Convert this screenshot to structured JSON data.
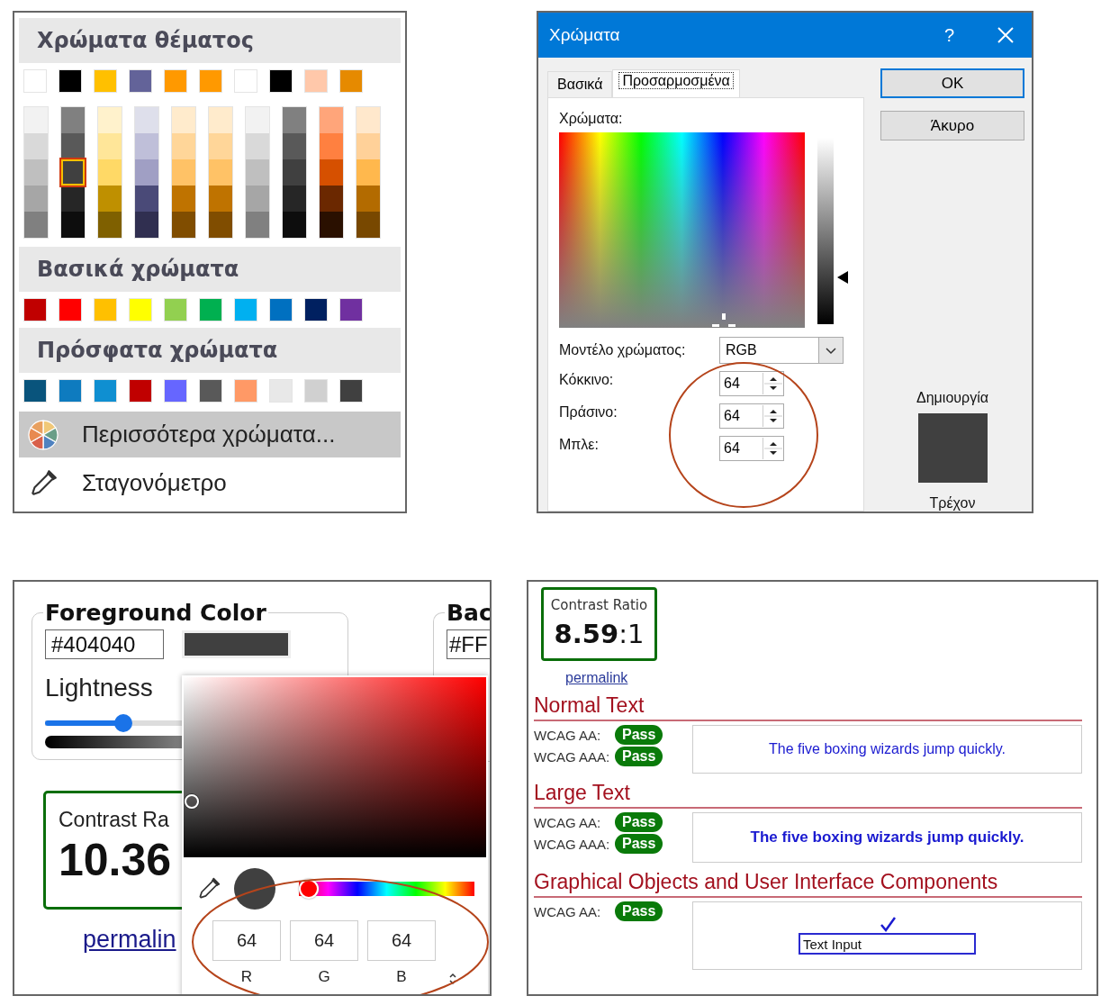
{
  "color_menu": {
    "theme_heading": "Χρώματα θέματος",
    "theme_colors": [
      {
        "color": "#ffffff",
        "shades": [
          {
            "color": "#f2f2f2",
            "selected": false
          },
          {
            "color": "#d9d9d9",
            "selected": false
          },
          {
            "color": "#bfbfbf",
            "selected": false
          },
          {
            "color": "#a6a6a6",
            "selected": false
          },
          {
            "color": "#808080",
            "selected": false
          }
        ]
      },
      {
        "color": "#000000",
        "shades": [
          {
            "color": "#808080",
            "selected": false
          },
          {
            "color": "#595959",
            "selected": false
          },
          {
            "color": "#404040",
            "selected": true
          },
          {
            "color": "#262626",
            "selected": false
          },
          {
            "color": "#0d0d0d",
            "selected": false
          }
        ]
      },
      {
        "color": "#ffc000",
        "shades": [
          {
            "color": "#fff2cc",
            "selected": false
          },
          {
            "color": "#ffe699",
            "selected": false
          },
          {
            "color": "#ffd966",
            "selected": false
          },
          {
            "color": "#bf9000",
            "selected": false
          },
          {
            "color": "#7f6000",
            "selected": false
          }
        ]
      },
      {
        "color": "#636399",
        "shades": [
          {
            "color": "#dedfeb",
            "selected": false
          },
          {
            "color": "#bfbfd9",
            "selected": false
          },
          {
            "color": "#a09fc4",
            "selected": false
          },
          {
            "color": "#4a4a78",
            "selected": false
          },
          {
            "color": "#302f50",
            "selected": false
          }
        ]
      },
      {
        "color": "#ff9900",
        "shades": [
          {
            "color": "#ffebcc",
            "selected": false
          },
          {
            "color": "#ffd699",
            "selected": false
          },
          {
            "color": "#ffc266",
            "selected": false
          },
          {
            "color": "#bf7300",
            "selected": false
          },
          {
            "color": "#804d00",
            "selected": false
          }
        ]
      },
      {
        "color": "#ff9900",
        "shades": [
          {
            "color": "#ffebcc",
            "selected": false
          },
          {
            "color": "#ffd699",
            "selected": false
          },
          {
            "color": "#ffc266",
            "selected": false
          },
          {
            "color": "#bf7300",
            "selected": false
          },
          {
            "color": "#804d00",
            "selected": false
          }
        ]
      },
      {
        "color": "#ffffff",
        "shades": [
          {
            "color": "#f2f2f2",
            "selected": false
          },
          {
            "color": "#d9d9d9",
            "selected": false
          },
          {
            "color": "#bfbfbf",
            "selected": false
          },
          {
            "color": "#a6a6a6",
            "selected": false
          },
          {
            "color": "#808080",
            "selected": false
          }
        ]
      },
      {
        "color": "#000000",
        "shades": [
          {
            "color": "#808080",
            "selected": false
          },
          {
            "color": "#595959",
            "selected": false
          },
          {
            "color": "#404040",
            "selected": false
          },
          {
            "color": "#262626",
            "selected": false
          },
          {
            "color": "#0d0d0d",
            "selected": false
          }
        ]
      },
      {
        "color": "#ffc8aa",
        "shades": [
          {
            "color": "#ffa57a",
            "selected": false
          },
          {
            "color": "#ff8040",
            "selected": false
          },
          {
            "color": "#d65000",
            "selected": false
          },
          {
            "color": "#6b2800",
            "selected": false
          },
          {
            "color": "#2a1000",
            "selected": false
          }
        ]
      },
      {
        "color": "#e68a00",
        "shades": [
          {
            "color": "#ffe8cc",
            "selected": false
          },
          {
            "color": "#ffd199",
            "selected": false
          },
          {
            "color": "#ffb84d",
            "selected": false
          },
          {
            "color": "#b36b00",
            "selected": false
          },
          {
            "color": "#784800",
            "selected": false
          }
        ]
      }
    ],
    "standard_heading": "Βασικά χρώματα",
    "standard_colors": [
      {
        "color": "#c00000"
      },
      {
        "color": "#ff0000"
      },
      {
        "color": "#ffc000"
      },
      {
        "color": "#ffff00"
      },
      {
        "color": "#92d050"
      },
      {
        "color": "#00b050"
      },
      {
        "color": "#00b0f0"
      },
      {
        "color": "#0070c0"
      },
      {
        "color": "#002060"
      },
      {
        "color": "#7030a0"
      }
    ],
    "recent_heading": "Πρόσφατα χρώματα",
    "recent_colors": [
      {
        "color": "#09547c"
      },
      {
        "color": "#0e7bbf"
      },
      {
        "color": "#0f8fd1"
      },
      {
        "color": "#c00000"
      },
      {
        "color": "#6666ff"
      },
      {
        "color": "#595959"
      },
      {
        "color": "#ff9966"
      },
      {
        "color": "#e8e8e8"
      },
      {
        "color": "#d0d0d0"
      },
      {
        "color": "#404040"
      }
    ],
    "items": [
      {
        "kind": "palette",
        "label": "Περισσότερα χρώματα...",
        "selected": true
      },
      {
        "kind": "eyedropper",
        "label": "Σταγονόμετρο",
        "selected": false
      }
    ]
  },
  "colors_dialog": {
    "title": "Χρώματα",
    "help": "?",
    "tabs": [
      {
        "label": "Βασικά",
        "selected": false
      },
      {
        "label": "Προσαρμοσμένα",
        "selected": true
      }
    ],
    "colors_label": "Χρώματα:",
    "luminance": {
      "level": 0.25
    },
    "model_label": "Μοντέλο χρώματος:",
    "model_value": "RGB",
    "channels": [
      {
        "label": "Κόκκινο:",
        "value": "64"
      },
      {
        "label": "Πράσινο:",
        "value": "64"
      },
      {
        "label": "Μπλε:",
        "value": "64"
      }
    ],
    "buttons": [
      {
        "label": "OK",
        "default": true
      },
      {
        "label": "Άκυρο",
        "default": false
      }
    ],
    "new_label": "Δημιουργία",
    "current_label": "Τρέχον"
  },
  "contrast_tool": {
    "foreground": {
      "legend": "Foreground Color",
      "hex": "#404040",
      "lightness_label": "Lightness",
      "lightness": {
        "level": 0.27
      }
    },
    "background": {
      "legend": "Bac",
      "hex": "#FF"
    },
    "contrast_label": "Contrast Ra",
    "ratio": "10.36",
    "permalink": "permalin",
    "picker": {
      "hue": {
        "level": 0
      },
      "fields": [
        {
          "value": "64",
          "label": "R"
        },
        {
          "value": "64",
          "label": "G"
        },
        {
          "value": "64",
          "label": "B"
        }
      ]
    }
  },
  "checker": {
    "label": "Contrast Ratio",
    "ratio": "**8.59**:1",
    "permalink": "permalink",
    "sections": [
      {
        "kind": "text",
        "heading": "Normal Text",
        "checks": [
          {
            "label": "WCAG AA:",
            "result": "Pass"
          },
          {
            "label": "WCAG AAA:",
            "result": "Pass"
          }
        ],
        "sample": "The five boxing wizards jump quickly."
      },
      {
        "kind": "large-text",
        "heading": "Large Text",
        "checks": [
          {
            "label": "WCAG AA:",
            "result": "Pass"
          },
          {
            "label": "WCAG AAA:",
            "result": "Pass"
          }
        ],
        "sample": "The five boxing wizards jump quickly."
      },
      {
        "kind": "graphics",
        "heading": "Graphical Objects and User Interface Components",
        "checks": [
          {
            "label": "WCAG AA:",
            "result": "Pass"
          }
        ],
        "sample": "Text Input"
      }
    ]
  }
}
